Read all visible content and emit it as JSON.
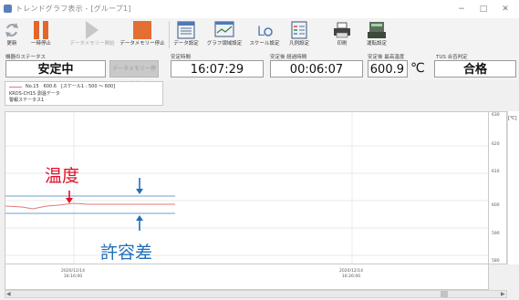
{
  "window": {
    "title": "トレンドグラフ表示 - [グループ1]",
    "controls": [
      "−",
      "□",
      "✕"
    ]
  },
  "toolbar": {
    "update": "更新",
    "pause": "一時停止",
    "data_memory_start": "データメモリー開始",
    "data_memory_stop": "データメモリー停止",
    "data_settings": "データ設定",
    "graph_area_settings": "グラフ領域設定",
    "scale_settings": "スケール設定",
    "legend_settings": "凡例設定",
    "print": "印刷",
    "operation_settings": "運転設定"
  },
  "status": {
    "label": "機器のステータス",
    "value": "安定中",
    "memory_status": "データメモリー停止中",
    "stable_time_label": "安定時間",
    "stable_time": "16:07:29",
    "elapsed_label": "安定後 経過時間",
    "elapsed": "00:06:07",
    "max_temp_label": "安定後 最高温度",
    "max_temp": "600.9",
    "max_temp_unit": "℃",
    "judgement_label": "TUS 合否判定",
    "judgement": "合格"
  },
  "legend": {
    "line1": "No.15　600.6　[スケール1 : 500 ～ 600]",
    "line2": "KRDS-CH15 測温データ",
    "line3": "警報ステータス1"
  },
  "chart": {
    "y_ticks": [
      "630",
      "620",
      "610",
      "600",
      "590",
      "580"
    ],
    "side_label": "[℃]",
    "x_ticks": [
      {
        "date": "2020/12/14",
        "time": "16:16:00"
      },
      {
        "date": "2020/12/14",
        "time": "16:26:00"
      }
    ]
  },
  "annotations": {
    "temperature": "温度",
    "tolerance": "許容差"
  },
  "colors": {
    "temp_line": "#e07a7a",
    "limit_line": "#6f9fcf",
    "annot_red": "#e0102a",
    "annot_blue": "#1f6fb8"
  },
  "icons": {
    "update": "refresh-icon",
    "pause": "pause-icon",
    "memory_start": "play-icon",
    "memory_stop": "stop-icon",
    "print": "printer-icon"
  }
}
